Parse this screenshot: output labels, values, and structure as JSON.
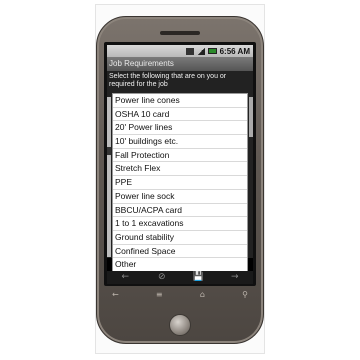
{
  "status_bar": {
    "time": "6:56 AM",
    "icons": [
      "sim-icon",
      "signal-icon",
      "battery-icon"
    ]
  },
  "app": {
    "title": "Job Requirements",
    "instruction": "Select the following that are on you or required for the job"
  },
  "list": {
    "items": [
      "Power line cones",
      "OSHA 10 card",
      "20' Power lines",
      "10' buildings etc.",
      "Fall Protection",
      "Stretch Flex",
      "PPE",
      "Power line sock",
      "BBCU/ACPA card",
      "1 to 1 excavations",
      "Ground stability",
      "Confined Space",
      "Other"
    ]
  },
  "softkeys": {
    "back": "←",
    "cancel": "⊘",
    "save": "💾",
    "forward": "→"
  },
  "phone_nav": {
    "back": "←",
    "menu": "≡",
    "home": "⌂",
    "search": "⚲"
  }
}
